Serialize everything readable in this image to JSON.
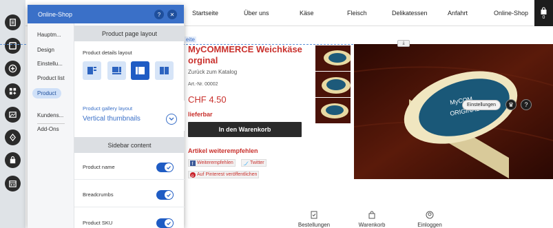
{
  "panel": {
    "title": "Online-Shop",
    "help_icon": "question-icon",
    "close_icon": "close-icon",
    "side_items": [
      "Hauptm...",
      "Design",
      "Einstellu...",
      "Product list",
      "Product",
      "Kundens...",
      "Add-Ons"
    ],
    "active_item": "Product",
    "sections": {
      "layout_title": "Product page layout",
      "details_label": "Product details layout",
      "gallery_label": "Product gallery layout",
      "gallery_value": "Vertical thumbnails",
      "sidebar_title": "Sidebar content"
    },
    "layout_options": [
      "layout-sidebar-left-icon",
      "layout-top-icon",
      "layout-sidebar-split-icon",
      "layout-columns-icon"
    ],
    "selected_layout_index": 2,
    "toggles": [
      {
        "label": "Product name",
        "on": true
      },
      {
        "label": "Breadcrumbs",
        "on": true
      },
      {
        "label": "Product SKU",
        "on": true
      }
    ]
  },
  "site": {
    "nav": [
      "Startseite",
      "Über uns",
      "Käse",
      "Fleisch",
      "Delikatessen",
      "Anfahrt",
      "Online-Shop"
    ],
    "cart_count": "0",
    "breadcrumb_tag": "eite"
  },
  "product": {
    "title": "MyCOMMERCE Weichkäse orginal",
    "back": "Zurück zum Katalog",
    "sku": "Art.-Nr. 00002",
    "price": "CHF 4.50",
    "availability": "lieferbar",
    "cart_button": "In den Warenkorb",
    "recommend_title": "Artikel weiterempfehlen",
    "share": {
      "facebook": "Weiterempfehlen",
      "twitter": "Twitter",
      "pinterest": "Auf Pinterest veröffentlichen"
    },
    "image_settings": "Einstellungen"
  },
  "footer": {
    "items": [
      "Bestellungen",
      "Warenkorb",
      "Einloggen"
    ]
  },
  "colors": {
    "accent": "#3a70c8",
    "brand_red": "#c9302c",
    "dark": "#2a2a2a"
  }
}
